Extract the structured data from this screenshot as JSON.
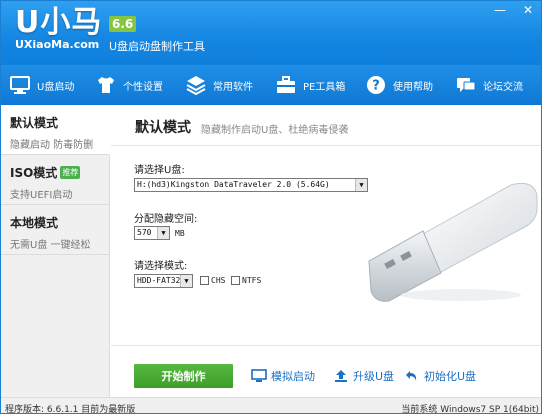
{
  "header": {
    "logo_main": "U小马",
    "logo_sub": "UXiaoMa.com",
    "version": "6.6",
    "subtitle": "U盘启动盘制作工具",
    "win_controls": [
      "—",
      "✕"
    ]
  },
  "nav": {
    "items": [
      {
        "label": "U盘启动",
        "icon": "monitor-icon"
      },
      {
        "label": "个性设置",
        "icon": "shirt-icon"
      },
      {
        "label": "常用软件",
        "icon": "layers-icon"
      },
      {
        "label": "PE工具箱",
        "icon": "toolbox-icon"
      },
      {
        "label": "使用帮助",
        "icon": "help-icon"
      },
      {
        "label": "论坛交流",
        "icon": "chat-icon"
      }
    ]
  },
  "sidebar": {
    "items": [
      {
        "title": "默认模式",
        "desc": "隐藏启动 防毒防删",
        "badge": ""
      },
      {
        "title": "ISO模式",
        "desc": "支持UEFI启动",
        "badge": "推荐"
      },
      {
        "title": "本地模式",
        "desc": "无需U盘 一键经松",
        "badge": ""
      }
    ]
  },
  "main": {
    "title": "默认模式",
    "hint": "隐藏制作启动U盘、杜绝病毒侵袭",
    "select_disk_label": "请选择U盘:",
    "disk_value": "H:(hd3)Kingston DataTraveler 2.0 (5.64G)",
    "hidden_space_label": "分配隐藏空间:",
    "hidden_space_value": "570",
    "hidden_space_unit": "MB",
    "mode_label": "请选择模式:",
    "mode_value": "HDD-FAT32",
    "chs_label": "CHS",
    "ntfs_label": "NTFS",
    "start_button": "开始制作",
    "simulate": "模拟启动",
    "upgrade": "升级U盘",
    "init": "初始化U盘"
  },
  "status": {
    "left": "程序版本: 6.6.1.1  目前为最新版",
    "right": "当前系统 Windows7 SP 1(64bit)"
  },
  "colors": {
    "header": "#1486e2",
    "nav": "#1078d4",
    "start": "#3d9e2a",
    "link": "#1b6fc4"
  }
}
